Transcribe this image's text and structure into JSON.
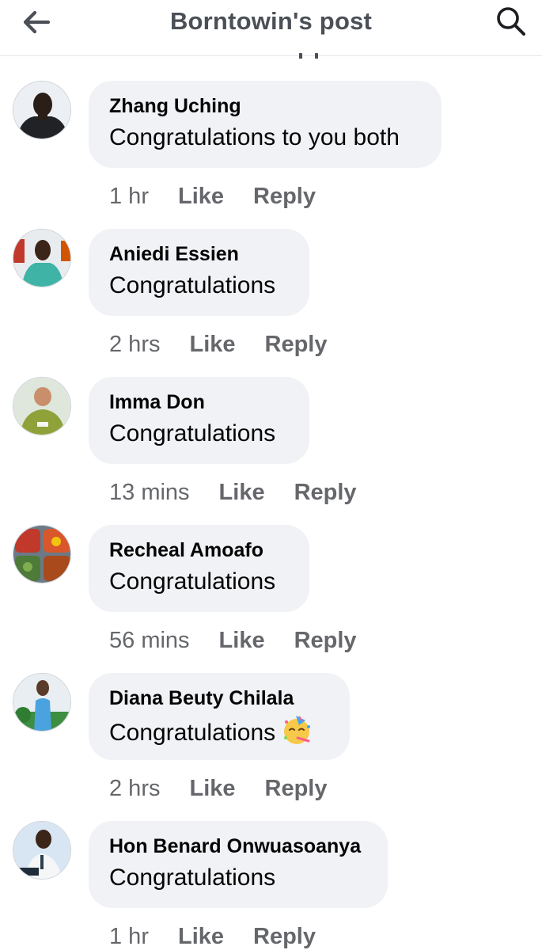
{
  "header": {
    "title": "Borntowin's post",
    "back_icon": "arrow-left-icon",
    "search_icon": "search-icon"
  },
  "colors": {
    "bubble_bg": "#f0f2f5",
    "meta_text": "#65676b",
    "header_text": "#4b4f56",
    "body_text": "#050505"
  },
  "comments": [
    {
      "author": "Zhang Uching",
      "text": "Congratulations to you both",
      "time": "1 hr",
      "like_label": "Like",
      "reply_label": "Reply"
    },
    {
      "author": "Aniedi Essien",
      "text": "Congratulations",
      "time": "2 hrs",
      "like_label": "Like",
      "reply_label": "Reply"
    },
    {
      "author": "Imma Don",
      "text": "Congratulations",
      "time": "13 mins",
      "like_label": "Like",
      "reply_label": "Reply"
    },
    {
      "author": "Recheal Amoafo",
      "text": "Congratulations",
      "time": "56 mins",
      "like_label": "Like",
      "reply_label": "Reply"
    },
    {
      "author": "Diana Beuty Chilala",
      "text": "Congratulations",
      "emoji": "partying-face-emoji",
      "time": "2 hrs",
      "like_label": "Like",
      "reply_label": "Reply"
    },
    {
      "author": "Hon Benard Onwuasoanya",
      "text": "Congratulations",
      "time": "1 hr",
      "like_label": "Like",
      "reply_label": "Reply"
    }
  ]
}
